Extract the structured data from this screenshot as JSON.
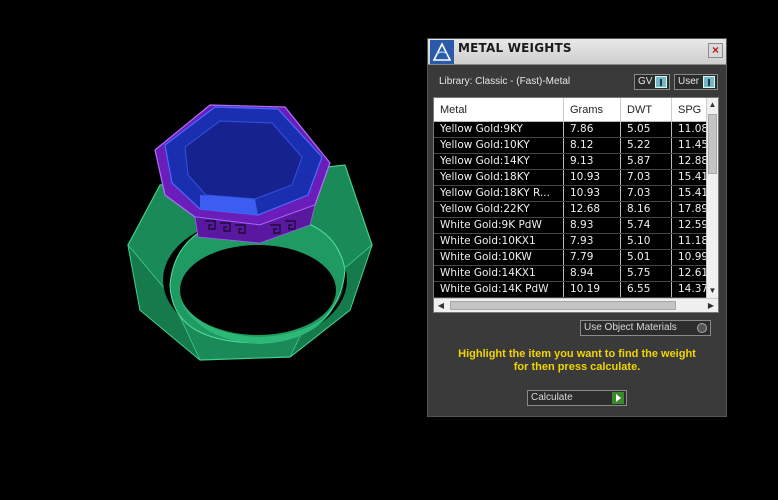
{
  "window": {
    "title": "METAL WEIGHTS",
    "close_label": "×"
  },
  "library": {
    "label": "Library: Classic - (Fast)-Metal"
  },
  "toggles": {
    "gv_label": "GV",
    "user_label": "User"
  },
  "table": {
    "columns": [
      "Metal",
      "Grams",
      "DWT",
      "SPG"
    ],
    "rows": [
      {
        "metal": "Yellow Gold:9KY",
        "grams": "7.86",
        "dwt": "5.05",
        "spg": "11.08"
      },
      {
        "metal": "Yellow Gold:10KY",
        "grams": "8.12",
        "dwt": "5.22",
        "spg": "11.45"
      },
      {
        "metal": "Yellow Gold:14KY",
        "grams": "9.13",
        "dwt": "5.87",
        "spg": "12.88"
      },
      {
        "metal": "Yellow Gold:18KY",
        "grams": "10.93",
        "dwt": "7.03",
        "spg": "15.41"
      },
      {
        "metal": "Yellow Gold:18KY R...",
        "grams": "10.93",
        "dwt": "7.03",
        "spg": "15.41"
      },
      {
        "metal": "Yellow Gold:22KY",
        "grams": "12.68",
        "dwt": "8.16",
        "spg": "17.89"
      },
      {
        "metal": "White Gold:9K PdW",
        "grams": "8.93",
        "dwt": "5.74",
        "spg": "12.59"
      },
      {
        "metal": "White Gold:10KX1",
        "grams": "7.93",
        "dwt": "5.10",
        "spg": "11.18"
      },
      {
        "metal": "White Gold:10KW",
        "grams": "7.79",
        "dwt": "5.01",
        "spg": "10.99"
      },
      {
        "metal": "White Gold:14KX1",
        "grams": "8.94",
        "dwt": "5.75",
        "spg": "12.61"
      },
      {
        "metal": "White Gold:14K PdW",
        "grams": "10.19",
        "dwt": "6.55",
        "spg": "14.37"
      }
    ]
  },
  "options": {
    "use_object_materials": "Use Object Materials"
  },
  "instructions": {
    "line1": "Highlight the item you want to find the weight",
    "line2": "for then press calculate."
  },
  "actions": {
    "calculate": "Calculate"
  },
  "colors": {
    "ring_band": "#1f9a63",
    "ring_head": "#7a22c9",
    "gemstone": "#1a2fb0",
    "instruction_text": "#f2d400"
  },
  "icons": {
    "app": "matrix-logo-icon",
    "close": "close-icon",
    "scroll_up": "chevron-up-icon",
    "scroll_down": "chevron-down-icon",
    "scroll_left": "chevron-left-icon",
    "scroll_right": "chevron-right-icon",
    "play": "play-icon"
  }
}
